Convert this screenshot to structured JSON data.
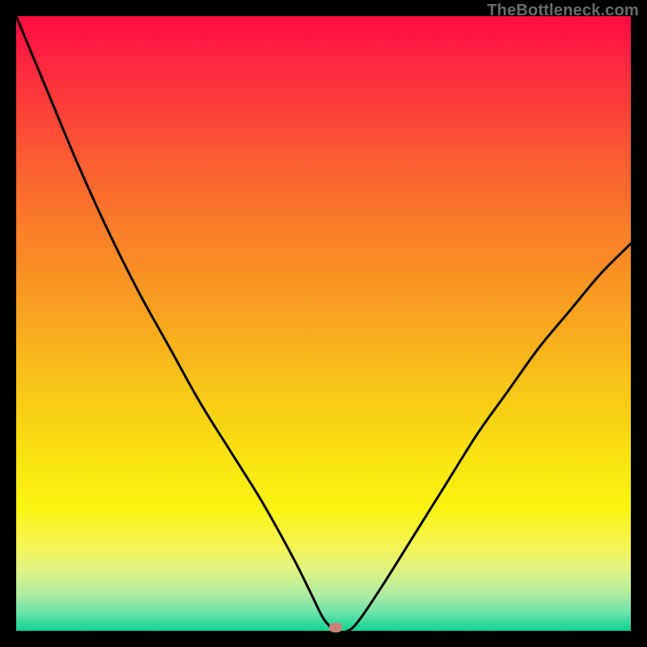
{
  "watermark": "TheBottleneck.com",
  "chart_data": {
    "type": "line",
    "title": "",
    "xlabel": "",
    "ylabel": "",
    "xlim": [
      0,
      100
    ],
    "ylim": [
      0,
      100
    ],
    "notes": "V-shaped bottleneck curve over a red→yellow→green vertical gradient background. Minimum at x≈52, y≈0. A rounded salmon marker sits at the valley floor.",
    "series": [
      {
        "name": "bottleneck-curve",
        "x": [
          0,
          5,
          10,
          15,
          20,
          25,
          30,
          35,
          40,
          45,
          48,
          50,
          52,
          54,
          56,
          60,
          65,
          70,
          75,
          80,
          85,
          90,
          95,
          100
        ],
        "values": [
          100,
          88,
          76,
          65,
          55,
          46,
          37,
          29,
          21,
          12,
          6,
          2,
          0,
          0,
          2,
          8,
          16,
          24,
          32,
          39,
          46,
          52,
          58,
          63
        ]
      }
    ],
    "marker": {
      "x": 52,
      "y": 0
    },
    "gradient_stops": [
      {
        "offset": 0.0,
        "color": "#fe0b43"
      },
      {
        "offset": 0.1,
        "color": "#fd2f3d"
      },
      {
        "offset": 0.22,
        "color": "#fb5833"
      },
      {
        "offset": 0.35,
        "color": "#f97f29"
      },
      {
        "offset": 0.48,
        "color": "#f8a220"
      },
      {
        "offset": 0.6,
        "color": "#f8c418"
      },
      {
        "offset": 0.72,
        "color": "#f9e411"
      },
      {
        "offset": 0.8,
        "color": "#faf312"
      },
      {
        "offset": 0.86,
        "color": "#f4f552"
      },
      {
        "offset": 0.9,
        "color": "#e0f383"
      },
      {
        "offset": 0.94,
        "color": "#b0eda0"
      },
      {
        "offset": 0.97,
        "color": "#6de2aa"
      },
      {
        "offset": 1.0,
        "color": "#0fd292"
      }
    ]
  }
}
